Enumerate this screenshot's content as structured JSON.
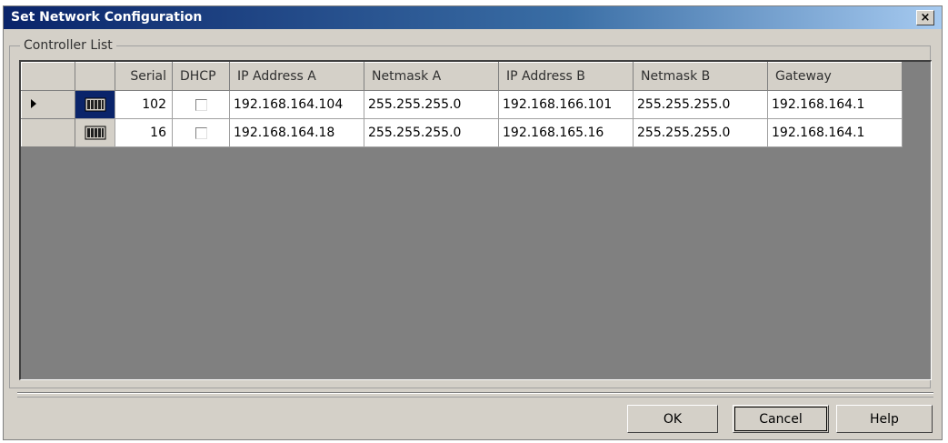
{
  "window": {
    "title": "Set Network Configuration",
    "close_glyph": "×"
  },
  "group": {
    "label": "Controller List"
  },
  "table": {
    "columns": [
      "",
      "",
      "Serial",
      "DHCP",
      "IP Address A",
      "Netmask A",
      "IP Address B",
      "Netmask B",
      "Gateway"
    ],
    "rows": [
      {
        "selected": true,
        "serial": "102",
        "dhcp": false,
        "ip_a": "192.168.164.104",
        "netmask_a": "255.255.255.0",
        "ip_b": "192.168.166.101",
        "netmask_b": "255.255.255.0",
        "gateway": "192.168.164.1"
      },
      {
        "selected": false,
        "serial": "16",
        "dhcp": false,
        "ip_a": "192.168.164.18",
        "netmask_a": "255.255.255.0",
        "ip_b": "192.168.165.16",
        "netmask_b": "255.255.255.0",
        "gateway": "192.168.164.1"
      }
    ]
  },
  "buttons": {
    "ok": "OK",
    "cancel": "Cancel",
    "help": "Help"
  },
  "icons": {
    "row_indicator": "row-pointer-icon",
    "controller": "controller-icon",
    "close": "close-icon"
  },
  "colors": {
    "title_start": "#0a246a",
    "title_end": "#a6caf0",
    "window_bg": "#d4d0c8",
    "grid_bg": "#808080",
    "selection": "#0a246a"
  }
}
